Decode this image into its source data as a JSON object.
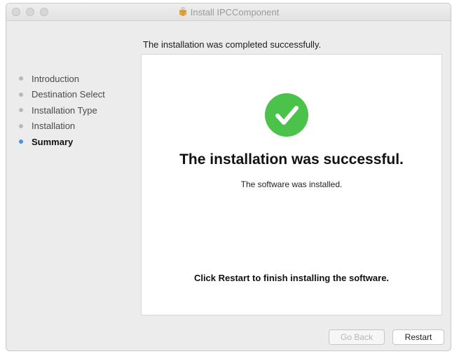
{
  "window": {
    "title": "Install IPCComponent",
    "title_icon": "package-icon"
  },
  "sidebar": {
    "items": [
      {
        "label": "Introduction",
        "state": "done"
      },
      {
        "label": "Destination Select",
        "state": "done"
      },
      {
        "label": "Installation Type",
        "state": "done"
      },
      {
        "label": "Installation",
        "state": "done"
      },
      {
        "label": "Summary",
        "state": "active"
      }
    ]
  },
  "main": {
    "heading": "The installation was completed successfully.",
    "status_icon": "checkmark-icon",
    "success_title": "The installation was successful.",
    "success_subtitle": "The software was installed.",
    "finish_note": "Click Restart to finish installing the software."
  },
  "buttons": {
    "back_label": "Go Back",
    "back_enabled": false,
    "restart_label": "Restart"
  },
  "colors": {
    "active_step": "#4a90e2",
    "success_green": "#4bc34a",
    "window_bg": "#ececec"
  }
}
